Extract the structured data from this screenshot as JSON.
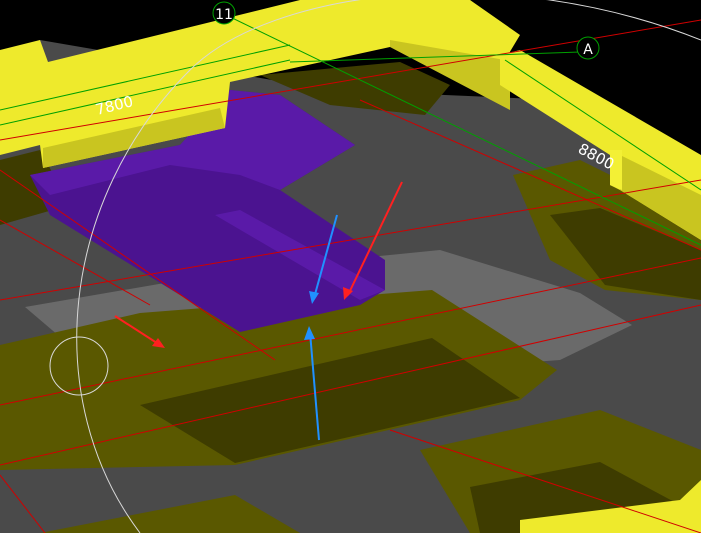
{
  "viewport": {
    "background_color": "#000000"
  },
  "grid_axes": [
    {
      "label": "11"
    },
    {
      "label": "A"
    }
  ],
  "dimensions": [
    {
      "label": "7800"
    },
    {
      "label": "8800"
    }
  ],
  "colors": {
    "slab": "#4a4a4a",
    "wall": "#eeea2c",
    "wall_side": "#c9c520",
    "wall_top": "#f3f035",
    "pit": "#5a5800",
    "pit_dark": "#3e3c00",
    "purple": "#4b1390",
    "purple_light": "#5a1aa8",
    "grey_platform": "#6a6a6a",
    "grid_red": "#d00000",
    "grid_green": "#00a000",
    "arrow_red": "#ff2020",
    "arrow_blue": "#2090ff",
    "circle_outline": "#d8d8d8"
  },
  "icons": [
    "orbit-circle-icon",
    "small-orbit-circle-icon"
  ]
}
